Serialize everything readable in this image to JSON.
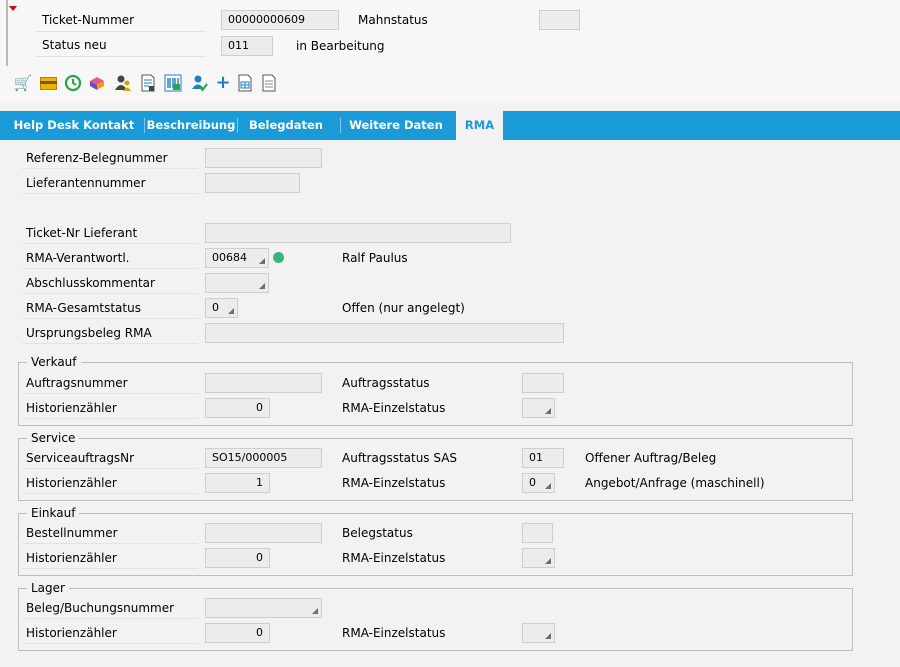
{
  "header": {
    "ticket_label": "Ticket-Nummer",
    "ticket_value": "00000000609",
    "mahnstatus_label": "Mahnstatus",
    "mahnstatus_value": "",
    "status_label": "Status neu",
    "status_value": "011",
    "status_text": "in Bearbeitung"
  },
  "toolbar": {
    "icons": [
      "cart-icon",
      "card-icon",
      "history-icon",
      "box-icon",
      "users-icon",
      "document-list-icon",
      "barcode-icon",
      "person-check-icon",
      "add-icon",
      "document-form-icon",
      "document-icon"
    ]
  },
  "tabs": [
    {
      "label": "Help Desk Kontakt"
    },
    {
      "label": "Beschreibung"
    },
    {
      "label": "Belegdaten"
    },
    {
      "label": "Weitere Daten"
    },
    {
      "label": "RMA"
    }
  ],
  "active_tab": "RMA",
  "form": {
    "referenz_label": "Referenz-Belegnummer",
    "referenz_value": "",
    "lieferant_label": "Lieferantennummer",
    "lieferant_value": "",
    "ticket_nr_lieferant_label": "Ticket-Nr Lieferant",
    "ticket_nr_lieferant_value": "",
    "rma_verantw_label": "RMA-Verantwortl.",
    "rma_verantw_value": "00684",
    "rma_verantw_name": "Ralf Paulus",
    "abschluss_label": "Abschlusskommentar",
    "abschluss_value": "",
    "gesamtstatus_label": "RMA-Gesamtstatus",
    "gesamtstatus_value": "0",
    "gesamtstatus_text": "Offen (nur angelegt)",
    "ursprung_label": "Ursprungsbeleg RMA",
    "ursprung_value": ""
  },
  "verkauf": {
    "title": "Verkauf",
    "auftragsnummer_label": "Auftragsnummer",
    "auftragsnummer_value": "",
    "auftragsstatus_label": "Auftragsstatus",
    "auftragsstatus_value": "",
    "historie_label": "Historienzähler",
    "historie_value": "0",
    "einzelstatus_label": "RMA-Einzelstatus",
    "einzelstatus_value": ""
  },
  "service": {
    "title": "Service",
    "auftragsnr_label": "ServiceauftragsNr",
    "auftragsnr_value": "SO15/000005",
    "auftragsstatus_label": "Auftragsstatus SAS",
    "auftragsstatus_value": "01",
    "auftragsstatus_text": "Offener Auftrag/Beleg",
    "historie_label": "Historienzähler",
    "historie_value": "1",
    "einzelstatus_label": "RMA-Einzelstatus",
    "einzelstatus_value": "0",
    "einzelstatus_text": "Angebot/Anfrage (maschinell)"
  },
  "einkauf": {
    "title": "Einkauf",
    "bestellnummer_label": "Bestellnummer",
    "bestellnummer_value": "",
    "belegstatus_label": "Belegstatus",
    "belegstatus_value": "",
    "historie_label": "Historienzähler",
    "historie_value": "0",
    "einzelstatus_label": "RMA-Einzelstatus",
    "einzelstatus_value": ""
  },
  "lager": {
    "title": "Lager",
    "beleg_label": "Beleg/Buchungsnummer",
    "beleg_value": "",
    "historie_label": "Historienzähler",
    "historie_value": "0",
    "einzelstatus_label": "RMA-Einzelstatus",
    "einzelstatus_value": ""
  }
}
